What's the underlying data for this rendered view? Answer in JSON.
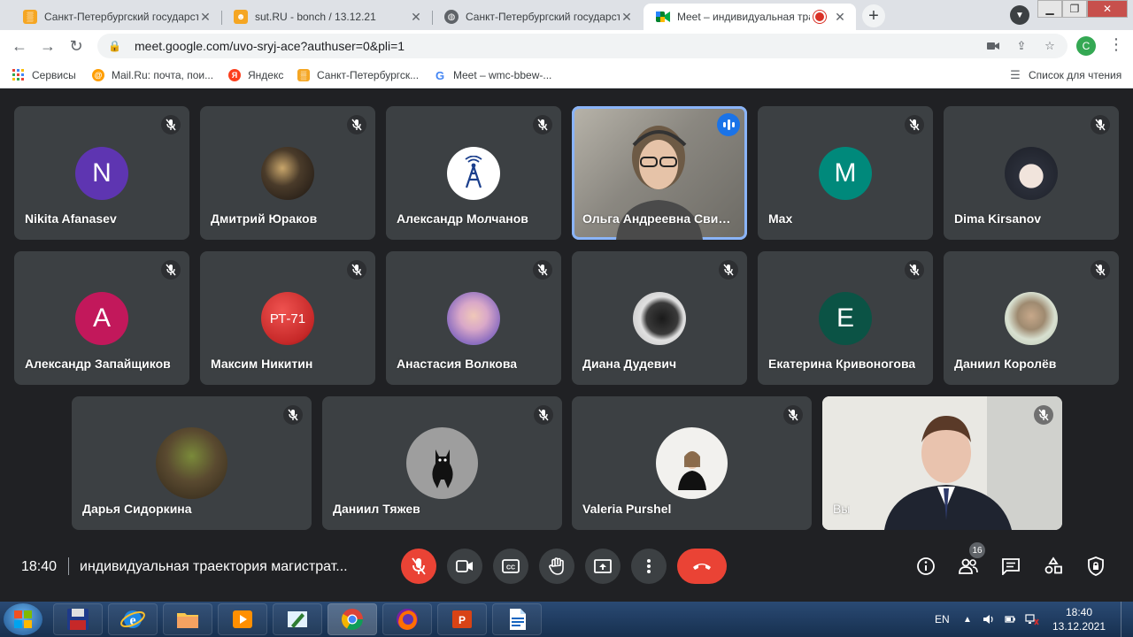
{
  "browser": {
    "tabs": [
      {
        "title": "Санкт-Петербургский государст…",
        "favicon_color": "#f5a623"
      },
      {
        "title": "sut.RU - bonch / 13.12.21",
        "favicon_color": "#f5a623"
      },
      {
        "title": "Санкт-Петербургский государст…",
        "favicon_color": "#5f6368"
      },
      {
        "title": "Meet – индивидуальная тра",
        "favicon_color": "#00897b"
      }
    ],
    "new_tab": "+",
    "address": "meet.google.com/uvo-sryj-ace?authuser=0&pli=1",
    "profile_initial": "C",
    "bookmarks": [
      {
        "label": "Сервисы"
      },
      {
        "label": "Mail.Ru: почта, пои..."
      },
      {
        "label": "Яндекс"
      },
      {
        "label": "Санкт-Петербургск..."
      },
      {
        "label": "Meet – wmc-bbew-..."
      }
    ],
    "reading_list": "Список для чтения"
  },
  "participants": [
    {
      "name": "Nikita Afanasev",
      "initial": "N",
      "color": "#5e35b1"
    },
    {
      "name": "Дмитрий Юраков",
      "initial": "",
      "color": "#4a3b2a"
    },
    {
      "name": "Александр Молчанов",
      "initial": "",
      "color": "#ffffff"
    },
    {
      "name": "Ольга Андреевна Сви…",
      "initial": "",
      "color": "#8a8780"
    },
    {
      "name": "Max",
      "initial": "M",
      "color": "#00897b"
    },
    {
      "name": "Dima Kirsanov",
      "initial": "",
      "color": "#2b2f3a"
    },
    {
      "name": "Александр Запайщиков",
      "initial": "A",
      "color": "#c2185b"
    },
    {
      "name": "Максим Никитин",
      "initial": "РТ-71",
      "color": "#d32f2f"
    },
    {
      "name": "Анастасия Волкова",
      "initial": "",
      "color": "#b39ddb"
    },
    {
      "name": "Диана Дудевич",
      "initial": "",
      "color": "#222222"
    },
    {
      "name": "Екатерина Кривоногова",
      "initial": "E",
      "color": "#0b5345"
    },
    {
      "name": "Даниил Королёв",
      "initial": "",
      "color": "#cfd8c9"
    },
    {
      "name": "Дарья Сидоркина",
      "initial": "",
      "color": "#5a4a30"
    },
    {
      "name": "Даниил Тяжев",
      "initial": "",
      "color": "#9e9e9e"
    },
    {
      "name": "Valeria Purshel",
      "initial": "",
      "color": "#e8e6e3"
    },
    {
      "name": "Вы",
      "initial": "",
      "color": "#e5e4df"
    }
  ],
  "meeting": {
    "time": "18:40",
    "name": "индивидуальная траектория магистрат...",
    "participants_count": "16"
  },
  "taskbar": {
    "language": "EN",
    "time": "18:40",
    "date": "13.12.2021"
  }
}
